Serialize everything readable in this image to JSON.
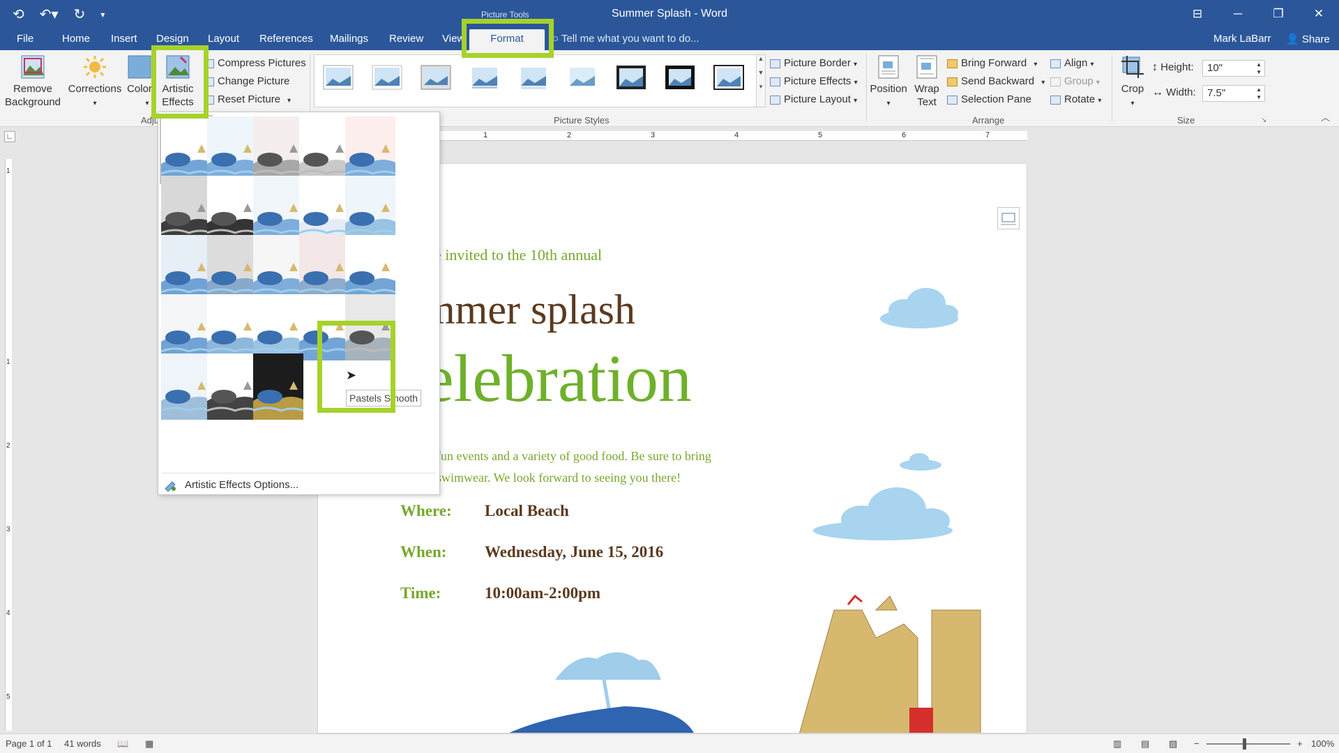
{
  "window": {
    "title": "Summer Splash - Word",
    "context_group": "Picture Tools",
    "controls": [
      "ribbon-display",
      "minimize",
      "restore",
      "close"
    ]
  },
  "tabs": [
    {
      "label": "File"
    },
    {
      "label": "Home"
    },
    {
      "label": "Insert"
    },
    {
      "label": "Design"
    },
    {
      "label": "Layout"
    },
    {
      "label": "References"
    },
    {
      "label": "Mailings"
    },
    {
      "label": "Review"
    },
    {
      "label": "View"
    },
    {
      "label": "Format"
    }
  ],
  "tell_me": "Tell me what you want to do...",
  "user": "Mark LaBarr",
  "share": "Share",
  "ribbon": {
    "remove_background": "Remove Background",
    "corrections": "Corrections",
    "color": "Color",
    "artistic_effects": "Artistic Effects",
    "compress": "Compress Pictures",
    "change": "Change Picture",
    "reset": "Reset Picture",
    "adjust_group": "Adjust",
    "picture_styles_group": "Picture Styles",
    "picture_border": "Picture Border",
    "picture_effects": "Picture Effects",
    "picture_layout": "Picture Layout",
    "position": "Position",
    "wrap_text": "Wrap Text",
    "bring_forward": "Bring Forward",
    "send_backward": "Send Backward",
    "selection_pane": "Selection Pane",
    "align": "Align",
    "group": "Group",
    "rotate": "Rotate",
    "arrange_group": "Arrange",
    "crop": "Crop",
    "height_label": "Height:",
    "height_value": "10\"",
    "width_label": "Width:",
    "width_value": "7.5\"",
    "size_group": "Size"
  },
  "ruler_marks": [
    "1",
    "2",
    "3",
    "4",
    "5",
    "6",
    "7"
  ],
  "vruler_marks": [
    "1",
    "1",
    "2",
    "3",
    "4",
    "5"
  ],
  "document": {
    "invite": "e invited to the 10th annual",
    "summer": "mmer splash",
    "celebration": "elebration",
    "body_line1": "fun events and a variety of good food. Be sure to bring",
    "body_line2": "swimwear. We look forward to seeing you there!",
    "where_label": "Where:",
    "where_value": "Local Beach",
    "when_label": "When:",
    "when_value": "Wednesday, June 15, 2016",
    "time_label": "Time:",
    "time_value": "10:00am-2:00pm"
  },
  "artistic_menu": {
    "tooltip": "Pastels Smooth",
    "options_label": "Artistic Effects Options..."
  },
  "status": {
    "page": "Page 1 of 1",
    "words": "41 words",
    "zoom": "100%"
  },
  "colors": {
    "accent": "#2b579a",
    "highlight": "#a6d22a",
    "green_text": "#76a72e",
    "brown_text": "#5b3a1f"
  }
}
